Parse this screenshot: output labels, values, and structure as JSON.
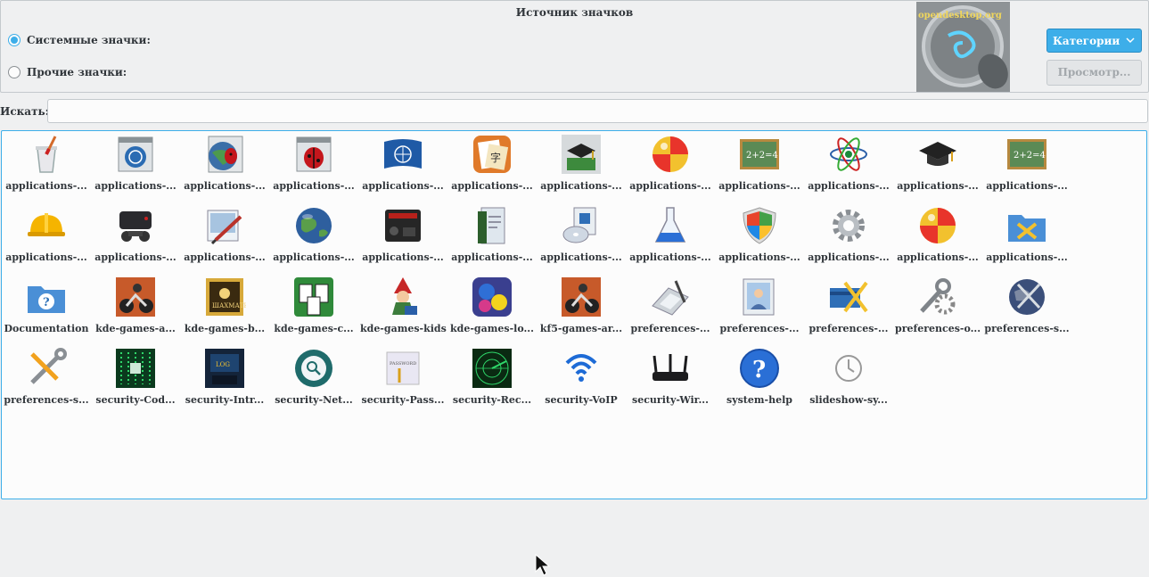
{
  "panel": {
    "title": "Источник значков",
    "system_icons_label": "Системные значки:",
    "other_icons_label": "Прочие значки:",
    "system_selected": true,
    "preview_brand": "opendesktop.org",
    "category_button": "Категории",
    "browse_button": "Просмотр..."
  },
  "search": {
    "label": "Искать:",
    "value": ""
  },
  "icons": [
    {
      "label": "applications-...",
      "icon": "trash-brush-icon"
    },
    {
      "label": "applications-...",
      "icon": "un-window-icon"
    },
    {
      "label": "applications-...",
      "icon": "globe-bug-icon"
    },
    {
      "label": "applications-...",
      "icon": "ladybug-window-icon"
    },
    {
      "label": "applications-...",
      "icon": "un-flag-icon"
    },
    {
      "label": "applications-...",
      "icon": "education-language-icon"
    },
    {
      "label": "applications-...",
      "icon": "school-books-icon"
    },
    {
      "label": "applications-...",
      "icon": "beach-ball-icon"
    },
    {
      "label": "applications-...",
      "icon": "chalkboard-math-icon"
    },
    {
      "label": "applications-...",
      "icon": "atom-icon"
    },
    {
      "label": "applications-...",
      "icon": "graduation-cap-icon"
    },
    {
      "label": "applications-...",
      "icon": "chalkboard-math-icon"
    },
    {
      "label": "applications-...",
      "icon": "hard-hat-icon"
    },
    {
      "label": "applications-...",
      "icon": "game-console-icon"
    },
    {
      "label": "applications-...",
      "icon": "graphics-brush-icon"
    },
    {
      "label": "applications-...",
      "icon": "globe-icon"
    },
    {
      "label": "applications-...",
      "icon": "arcade-console-icon"
    },
    {
      "label": "applications-...",
      "icon": "office-book-icon"
    },
    {
      "label": "applications-...",
      "icon": "kde-disc-icon"
    },
    {
      "label": "applications-...",
      "icon": "flask-icon"
    },
    {
      "label": "applications-...",
      "icon": "windows-shield-icon"
    },
    {
      "label": "applications-...",
      "icon": "gear-icon"
    },
    {
      "label": "applications-...",
      "icon": "beach-ball-icon"
    },
    {
      "label": "applications-...",
      "icon": "folder-tools-icon"
    },
    {
      "label": "Documentation",
      "icon": "help-folder-icon"
    },
    {
      "label": "kde-games-a...",
      "icon": "motorbike-icon"
    },
    {
      "label": "kde-games-b...",
      "icon": "chess-board-icon"
    },
    {
      "label": "kde-games-c...",
      "icon": "playing-cards-icon"
    },
    {
      "label": "kde-games-kids",
      "icon": "gnome-kid-icon"
    },
    {
      "label": "kde-games-lo...",
      "icon": "kde-hexagon-icon"
    },
    {
      "label": "kf5-games-ar...",
      "icon": "motorbike-icon"
    },
    {
      "label": "preferences-...",
      "icon": "graphics-tablet-icon"
    },
    {
      "label": "preferences-...",
      "icon": "photo-frame-icon"
    },
    {
      "label": "preferences-...",
      "icon": "card-tools-icon"
    },
    {
      "label": "preferences-o...",
      "icon": "wrench-gear-icon"
    },
    {
      "label": "preferences-s...",
      "icon": "globe-tools-icon"
    },
    {
      "label": "preferences-s...",
      "icon": "screwdriver-wrench-icon"
    },
    {
      "label": "security-Cod...",
      "icon": "matrix-code-icon"
    },
    {
      "label": "security-Intr...",
      "icon": "hacker-screen-icon"
    },
    {
      "label": "security-Net...",
      "icon": "network-search-icon"
    },
    {
      "label": "security-Pass...",
      "icon": "password-note-icon"
    },
    {
      "label": "security-Rec...",
      "icon": "radar-icon"
    },
    {
      "label": "security-VoIP",
      "icon": "wifi-icon"
    },
    {
      "label": "security-Wir...",
      "icon": "wireless-router-icon"
    },
    {
      "label": "system-help",
      "icon": "help-circle-icon"
    },
    {
      "label": "slideshow-sy...",
      "icon": "clock-icon"
    }
  ],
  "colors": {
    "accent": "#3daee9",
    "window_bg": "#eff0f1",
    "view_bg": "#fcfcfc",
    "text": "#31363b"
  }
}
